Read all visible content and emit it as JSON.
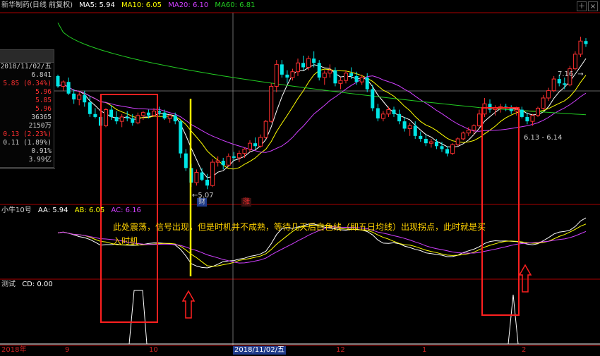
{
  "window": {
    "title": "新华制药(日线 前复权)",
    "ma": {
      "ma5": "MA5: 5.94",
      "ma10": "MA10: 6.05",
      "ma20": "MA20: 6.10",
      "ma60": "MA60: 6.81"
    },
    "buttons": [
      "＋",
      "×"
    ]
  },
  "info_panel": {
    "date": "2018/11/02/五",
    "rows": [
      "6.841",
      "5.85 (0.34%)",
      "5.96",
      "5.85",
      "5.96",
      "36365",
      "2150万",
      "0.13 (2.23%)",
      "0.11 (1.89%)",
      "0.91%",
      "3.99亿"
    ]
  },
  "price_labels": {
    "low_marker": "5.07",
    "high_marker": "7.16",
    "right_marker": "6.13 - 6.14",
    "tag_cai": "财",
    "tag_zhang": "涨"
  },
  "indicator1": {
    "name": "小牛10号",
    "aa": "AA: 5.94",
    "ab": "AB: 6.05",
    "ac": "AC: 6.16"
  },
  "indicator2": {
    "name": "测试",
    "cd": "CD: 0.00"
  },
  "annotation": "此处震荡，信号出现，但是时机并不成熟，等待几天后白色线（即五日均线）出现拐点，此时就是买入时机",
  "x_axis": {
    "labels": [
      "2018年",
      "9",
      "10",
      "2018/11/02/五",
      "12",
      "1",
      "2"
    ],
    "selected": "2018/11/02/五"
  },
  "colors": {
    "up": "#ff3030",
    "down": "#00e5e5",
    "ma5": "#ffffff",
    "ma10": "#ffff00",
    "ma20": "#d040ff",
    "ma60": "#22cc22",
    "frame": "#aa0000",
    "annotation_box": "#ff2020",
    "signal_line": "#ffee00"
  },
  "chart_data": {
    "type": "candlestick",
    "candles": [
      [
        6.62,
        6.64,
        6.46,
        6.48
      ],
      [
        6.48,
        6.56,
        6.42,
        6.54
      ],
      [
        6.54,
        6.6,
        6.36,
        6.38
      ],
      [
        6.38,
        6.44,
        6.24,
        6.3
      ],
      [
        6.3,
        6.4,
        6.22,
        6.36
      ],
      [
        6.36,
        6.42,
        6.2,
        6.26
      ],
      [
        6.26,
        6.34,
        6.06,
        6.1
      ],
      [
        6.1,
        6.18,
        6.04,
        6.06
      ],
      [
        6.06,
        6.14,
        5.9,
        5.94
      ],
      [
        5.94,
        6.18,
        5.92,
        6.16
      ],
      [
        6.16,
        6.22,
        6.02,
        6.06
      ],
      [
        6.06,
        6.14,
        5.96,
        6.0
      ],
      [
        6.0,
        6.1,
        5.92,
        6.06
      ],
      [
        6.06,
        6.14,
        6.0,
        6.04
      ],
      [
        6.04,
        6.1,
        5.94,
        5.98
      ],
      [
        5.98,
        6.12,
        5.96,
        6.08
      ],
      [
        6.08,
        6.14,
        6.02,
        6.12
      ],
      [
        6.12,
        6.16,
        6.04,
        6.08
      ],
      [
        6.08,
        6.18,
        6.06,
        6.14
      ],
      [
        6.14,
        6.2,
        6.08,
        6.12
      ],
      [
        6.12,
        6.16,
        6.02,
        6.04
      ],
      [
        6.04,
        6.1,
        5.98,
        6.08
      ],
      [
        6.08,
        6.12,
        5.96,
        6.0
      ],
      [
        6.0,
        6.02,
        5.5,
        5.56
      ],
      [
        5.56,
        5.62,
        5.32,
        5.36
      ],
      [
        5.36,
        5.42,
        5.1,
        5.16
      ],
      [
        5.16,
        5.34,
        5.12,
        5.3
      ],
      [
        5.3,
        5.36,
        5.18,
        5.2
      ],
      [
        5.2,
        5.28,
        5.07,
        5.12
      ],
      [
        5.12,
        5.48,
        5.1,
        5.44
      ],
      [
        5.44,
        5.52,
        5.38,
        5.46
      ],
      [
        5.46,
        5.5,
        5.34,
        5.4
      ],
      [
        5.4,
        5.56,
        5.38,
        5.52
      ],
      [
        5.52,
        5.58,
        5.46,
        5.5
      ],
      [
        5.5,
        5.6,
        5.44,
        5.56
      ],
      [
        5.56,
        5.64,
        5.5,
        5.62
      ],
      [
        5.62,
        5.74,
        5.58,
        5.7
      ],
      [
        5.7,
        5.78,
        5.62,
        5.66
      ],
      [
        5.66,
        5.82,
        5.64,
        5.78
      ],
      [
        5.78,
        6.02,
        5.76,
        6.0
      ],
      [
        6.0,
        6.52,
        5.98,
        6.48
      ],
      [
        6.48,
        6.84,
        6.4,
        6.78
      ],
      [
        6.78,
        6.84,
        6.6,
        6.64
      ],
      [
        6.64,
        6.7,
        6.52,
        6.6
      ],
      [
        6.6,
        6.72,
        6.56,
        6.68
      ],
      [
        6.68,
        6.86,
        6.62,
        6.8
      ],
      [
        6.8,
        6.9,
        6.7,
        6.74
      ],
      [
        6.74,
        6.9,
        6.7,
        6.86
      ],
      [
        6.86,
        6.96,
        6.74,
        6.8
      ],
      [
        6.8,
        6.84,
        6.56,
        6.6
      ],
      [
        6.6,
        6.7,
        6.5,
        6.66
      ],
      [
        6.66,
        6.78,
        6.6,
        6.7
      ],
      [
        6.7,
        6.74,
        6.48,
        6.52
      ],
      [
        6.52,
        6.6,
        6.44,
        6.56
      ],
      [
        6.56,
        6.7,
        6.52,
        6.66
      ],
      [
        6.66,
        6.74,
        6.58,
        6.62
      ],
      [
        6.62,
        6.68,
        6.5,
        6.54
      ],
      [
        6.54,
        6.64,
        6.5,
        6.6
      ],
      [
        6.6,
        6.66,
        6.4,
        6.44
      ],
      [
        6.44,
        6.5,
        6.14,
        6.18
      ],
      [
        6.18,
        6.24,
        6.0,
        6.04
      ],
      [
        6.04,
        6.14,
        6.0,
        6.1
      ],
      [
        6.1,
        6.2,
        6.06,
        6.16
      ],
      [
        6.16,
        6.2,
        6.06,
        6.1
      ],
      [
        6.1,
        6.16,
        5.96,
        6.0
      ],
      [
        6.0,
        6.06,
        5.86,
        5.9
      ],
      [
        5.9,
        5.98,
        5.8,
        5.94
      ],
      [
        5.94,
        6.0,
        5.76,
        5.8
      ],
      [
        5.8,
        5.86,
        5.72,
        5.76
      ],
      [
        5.76,
        5.82,
        5.66,
        5.7
      ],
      [
        5.7,
        5.76,
        5.64,
        5.72
      ],
      [
        5.72,
        5.76,
        5.62,
        5.66
      ],
      [
        5.66,
        5.72,
        5.58,
        5.62
      ],
      [
        5.62,
        5.66,
        5.52,
        5.56
      ],
      [
        5.56,
        5.7,
        5.54,
        5.68
      ],
      [
        5.68,
        5.78,
        5.66,
        5.76
      ],
      [
        5.76,
        5.86,
        5.74,
        5.84
      ],
      [
        5.84,
        5.92,
        5.8,
        5.88
      ],
      [
        5.88,
        5.96,
        5.82,
        5.94
      ],
      [
        5.94,
        6.16,
        5.92,
        6.1
      ],
      [
        6.1,
        6.32,
        6.06,
        6.24
      ],
      [
        6.24,
        6.3,
        6.12,
        6.16
      ],
      [
        6.16,
        6.22,
        6.08,
        6.18
      ],
      [
        6.18,
        6.24,
        6.12,
        6.2
      ],
      [
        6.2,
        6.24,
        6.14,
        6.18
      ],
      [
        6.18,
        6.22,
        6.1,
        6.14
      ],
      [
        6.14,
        6.2,
        6.08,
        6.16
      ],
      [
        6.16,
        6.2,
        6.04,
        6.06
      ],
      [
        6.06,
        6.12,
        5.96,
        6.0
      ],
      [
        6.0,
        6.1,
        5.94,
        6.08
      ],
      [
        6.08,
        6.2,
        6.06,
        6.18
      ],
      [
        6.18,
        6.36,
        6.16,
        6.32
      ],
      [
        6.32,
        6.46,
        6.28,
        6.42
      ],
      [
        6.42,
        6.62,
        6.4,
        6.58
      ],
      [
        6.58,
        6.64,
        6.48,
        6.52
      ],
      [
        6.52,
        6.6,
        6.44,
        6.5
      ],
      [
        6.5,
        6.76,
        6.48,
        6.72
      ],
      [
        6.72,
        6.96,
        6.7,
        6.92
      ],
      [
        6.92,
        7.16,
        6.88,
        7.1
      ],
      [
        7.1,
        7.14,
        7.02,
        7.06
      ]
    ],
    "ylim": [
      4.9,
      7.45
    ]
  }
}
